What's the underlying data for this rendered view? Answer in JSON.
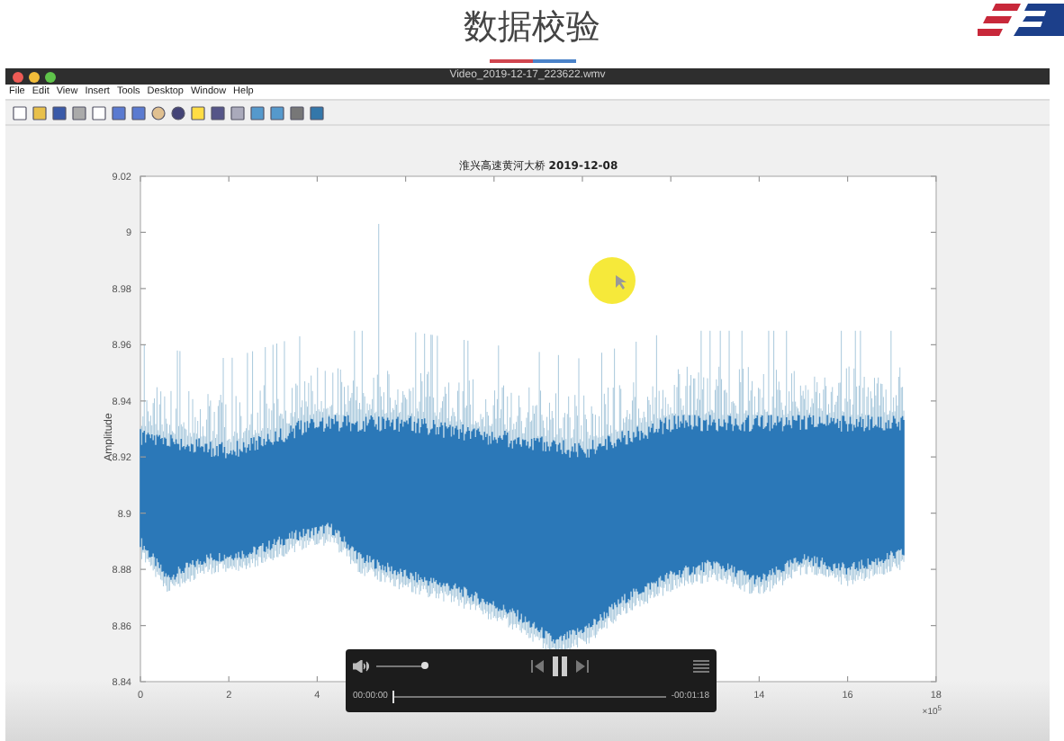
{
  "slide": {
    "title": "数据校验"
  },
  "window": {
    "title": "Video_2019-12-17_223622.wmv"
  },
  "menu": [
    "File",
    "Edit",
    "View",
    "Insert",
    "Tools",
    "Desktop",
    "Window",
    "Help"
  ],
  "plot": {
    "title_place": "淮兴高速黄河大桥",
    "title_date": "2019-12-08",
    "ylabel": "Amplitude",
    "yticks": [
      "9.02",
      "9",
      "8.98",
      "8.96",
      "8.94",
      "8.92",
      "8.9",
      "8.88",
      "8.86",
      "8.84"
    ],
    "xticks": [
      "0",
      "2",
      "4",
      "14",
      "16",
      "18"
    ],
    "x_multiplier": {
      "base": "×10",
      "exponent": "5"
    }
  },
  "player": {
    "volume": {
      "level": 1
    },
    "progress": {
      "level": 0
    },
    "elapsed": "00:00:00",
    "remaining": "-00:01:18"
  }
}
